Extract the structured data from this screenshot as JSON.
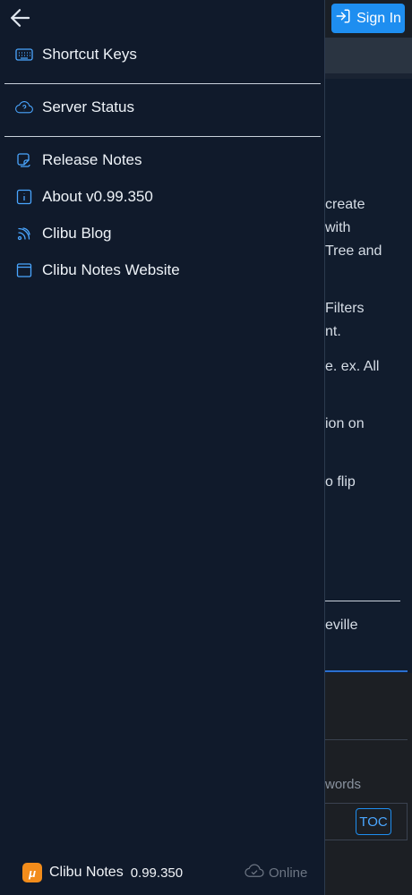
{
  "header": {
    "sign_in_label": "Sign In"
  },
  "background_text": {
    "lines": [
      "create",
      " with",
      "Tree and",
      "Filters",
      "nt.",
      "e. ex. All",
      "ion on",
      "o flip",
      "eville"
    ],
    "words_label": "words",
    "toc_label": "TOC"
  },
  "drawer": {
    "items": [
      {
        "label": "Shortcut Keys",
        "icon": "keyboard-icon"
      },
      {
        "label": "Server Status",
        "icon": "cloud-status-icon"
      },
      {
        "label": "Release Notes",
        "icon": "notes-icon"
      },
      {
        "label": "About v0.99.350",
        "icon": "info-icon"
      },
      {
        "label": "Clibu Blog",
        "icon": "feed-icon"
      },
      {
        "label": "Clibu Notes Website",
        "icon": "browser-window-icon"
      }
    ]
  },
  "footer": {
    "logo_glyph": "μ",
    "app_name": "Clibu Notes",
    "version": "0.99.350",
    "status": "Online",
    "status_icon": "cloud-check-icon"
  },
  "colors": {
    "accent": "#1e8ef0",
    "drawer_bg": "#101a2b",
    "icon_blue": "#4aa6ff",
    "logo_orange": "#f28c1b"
  }
}
